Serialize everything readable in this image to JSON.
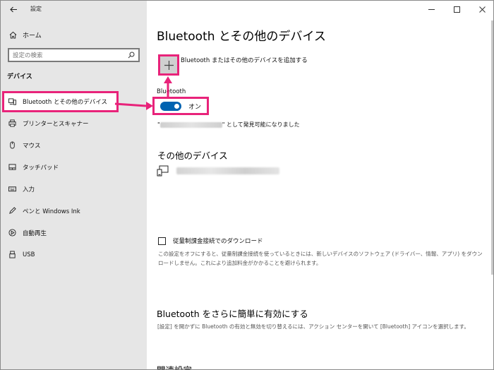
{
  "window": {
    "app_title": "設定",
    "controls": {
      "minimize": "—",
      "maximize": "☐",
      "close": "✕"
    }
  },
  "sidebar": {
    "home_label": "ホーム",
    "search_placeholder": "設定の検索",
    "section_title": "デバイス",
    "items": [
      {
        "label": "Bluetooth とその他のデバイス",
        "icon": "bluetooth-devices-icon",
        "active": true
      },
      {
        "label": "プリンターとスキャナー",
        "icon": "printer-icon",
        "active": false
      },
      {
        "label": "マウス",
        "icon": "mouse-icon",
        "active": false
      },
      {
        "label": "タッチパッド",
        "icon": "touchpad-icon",
        "active": false
      },
      {
        "label": "入力",
        "icon": "keyboard-icon",
        "active": false
      },
      {
        "label": "ペンと Windows Ink",
        "icon": "pen-icon",
        "active": false
      },
      {
        "label": "自動再生",
        "icon": "autoplay-icon",
        "active": false
      },
      {
        "label": "USB",
        "icon": "usb-icon",
        "active": false
      }
    ]
  },
  "main": {
    "title": "Bluetooth とその他のデバイス",
    "add_device_label": "Bluetooth またはその他のデバイスを追加する",
    "bluetooth_label": "Bluetooth",
    "toggle_state": "オン",
    "discoverable_prefix": "\"",
    "discoverable_suffix": "\" として発見可能になりました",
    "other_devices_title": "その他のデバイス",
    "metered_label": "従量制課金接続でのダウンロード",
    "metered_desc": "この設定をオフにすると、従量制課金接続を使っているときには、新しいデバイスのソフトウェア (ドライバー、情報、アプリ) をダウンロードしません。これにより追加料金がかかることを避けられます。",
    "easy_title": "Bluetooth をさらに簡単に有効にする",
    "easy_desc": "[設定] を開かずに Bluetooth の有効と無効を切り替えるには、アクション センターを開いて [Bluetooth] アイコンを選択します。",
    "related_title": "関連設定"
  },
  "colors": {
    "highlight": "#e8237a",
    "toggle_on": "#0063b1",
    "sidebar_bg": "#e6e6e6"
  }
}
